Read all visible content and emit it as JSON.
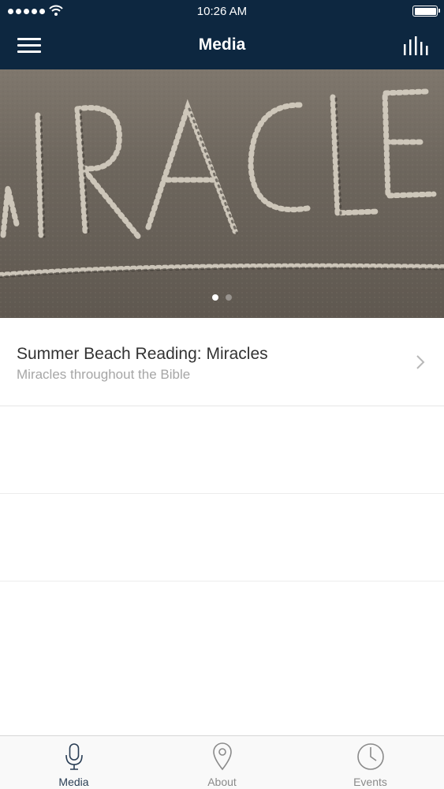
{
  "status_bar": {
    "time": "10:26 AM"
  },
  "nav": {
    "title": "Media"
  },
  "hero": {
    "image_text": "MIRACLES",
    "page_count": 2,
    "active_page": 1
  },
  "media_list": [
    {
      "title": "Summer Beach Reading: Miracles",
      "subtitle": "Miracles throughout the Bible"
    }
  ],
  "tabs": [
    {
      "label": "Media",
      "icon": "microphone-icon",
      "active": true
    },
    {
      "label": "About",
      "icon": "map-pin-icon",
      "active": false
    },
    {
      "label": "Events",
      "icon": "clock-icon",
      "active": false
    }
  ],
  "colors": {
    "nav_background": "#0d2740",
    "active_tab": "#2a3e55",
    "inactive_tab": "#8a8a8a",
    "subtitle": "#a6a6a6"
  }
}
